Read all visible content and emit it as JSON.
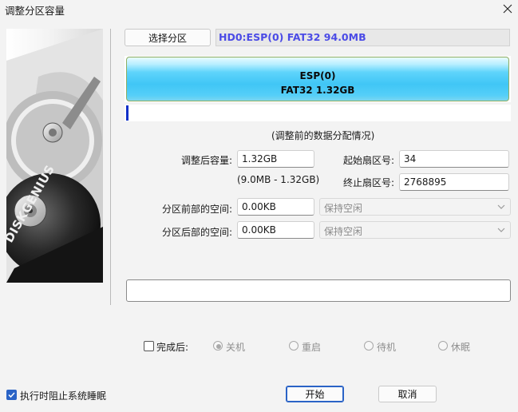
{
  "window": {
    "title": "调整分区容量"
  },
  "partition": {
    "select_label": "选择分区",
    "info": "HD0:ESP(0) FAT32 94.0MB",
    "bar_name": "ESP(0)",
    "bar_detail": "FAT32 1.32GB",
    "used_fraction": 0.0
  },
  "banner": {
    "brand": "DISKGENIUS"
  },
  "hint": "(调整前的数据分配情况)",
  "form": {
    "new_size_label": "调整后容量:",
    "new_size_value": "1.32GB",
    "size_range": "(9.0MB - 1.32GB)",
    "start_sector_label": "起始扇区号:",
    "start_sector_value": "34",
    "end_sector_label": "终止扇区号:",
    "end_sector_value": "2768895",
    "before_space_label": "分区前部的空间:",
    "before_space_value": "0.00KB",
    "before_space_option": "保持空闲",
    "after_space_label": "分区后部的空间:",
    "after_space_value": "0.00KB",
    "after_space_option": "保持空闲"
  },
  "after_complete": {
    "label": "完成后:",
    "checked": false,
    "options": [
      "关机",
      "重启",
      "待机",
      "休眠"
    ],
    "selected": "关机"
  },
  "prevent_sleep": {
    "label": "执行时阻止系统睡眠",
    "checked": true
  },
  "buttons": {
    "start": "开始",
    "cancel": "取消"
  }
}
